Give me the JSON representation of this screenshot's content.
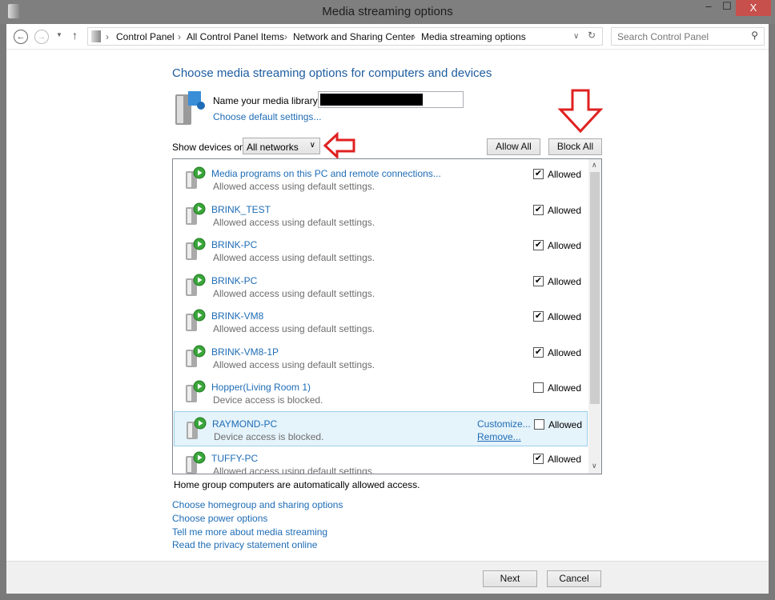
{
  "window": {
    "title": "Media streaming options",
    "close": "X",
    "minimize": "–",
    "maximize": "☐"
  },
  "nav": {
    "breadcrumb": [
      "Control Panel",
      "All Control Panel Items",
      "Network and Sharing Center",
      "Media streaming options"
    ],
    "search_placeholder": "Search Control Panel"
  },
  "main": {
    "heading": "Choose media streaming options for computers and devices",
    "library_label": "Name your media library:",
    "library_value": "",
    "default_settings_link": "Choose default settings...",
    "show_devices_label": "Show devices on:",
    "show_devices_value": "All networks",
    "allow_all": "Allow All",
    "block_all": "Block All",
    "devices": [
      {
        "name": "Media programs on this PC and remote connections...",
        "status": "Allowed access using default settings.",
        "allowed": true,
        "label": "Allowed"
      },
      {
        "name": "BRINK_TEST",
        "status": "Allowed access using default settings.",
        "allowed": true,
        "label": "Allowed"
      },
      {
        "name": "BRINK-PC",
        "status": "Allowed access using default settings.",
        "allowed": true,
        "label": "Allowed"
      },
      {
        "name": "BRINK-PC",
        "status": "Allowed access using default settings.",
        "allowed": true,
        "label": "Allowed"
      },
      {
        "name": "BRINK-VM8",
        "status": "Allowed access using default settings.",
        "allowed": true,
        "label": "Allowed"
      },
      {
        "name": "BRINK-VM8-1P",
        "status": "Allowed access using default settings.",
        "allowed": true,
        "label": "Allowed"
      },
      {
        "name": "Hopper(Living Room 1)",
        "status": "Device access is blocked.",
        "allowed": false,
        "label": "Allowed"
      },
      {
        "name": "RAYMOND-PC",
        "status": "Device access is blocked.",
        "allowed": false,
        "label": "Allowed",
        "selected": true,
        "customize": "Customize...",
        "remove": "Remove..."
      },
      {
        "name": "TUFFY-PC",
        "status": "Allowed access using default settings.",
        "allowed": true,
        "label": "Allowed"
      }
    ],
    "homegroup_note": "Home group computers are automatically allowed access.",
    "links": [
      "Choose homegroup and sharing options",
      "Choose power options",
      "Tell me more about media streaming",
      "Read the privacy statement online"
    ]
  },
  "footer": {
    "next": "Next",
    "cancel": "Cancel"
  },
  "colors": {
    "link": "#1e6cb5",
    "annotation_arrow": "#e02020",
    "selected_row": "#e5f3fb"
  }
}
